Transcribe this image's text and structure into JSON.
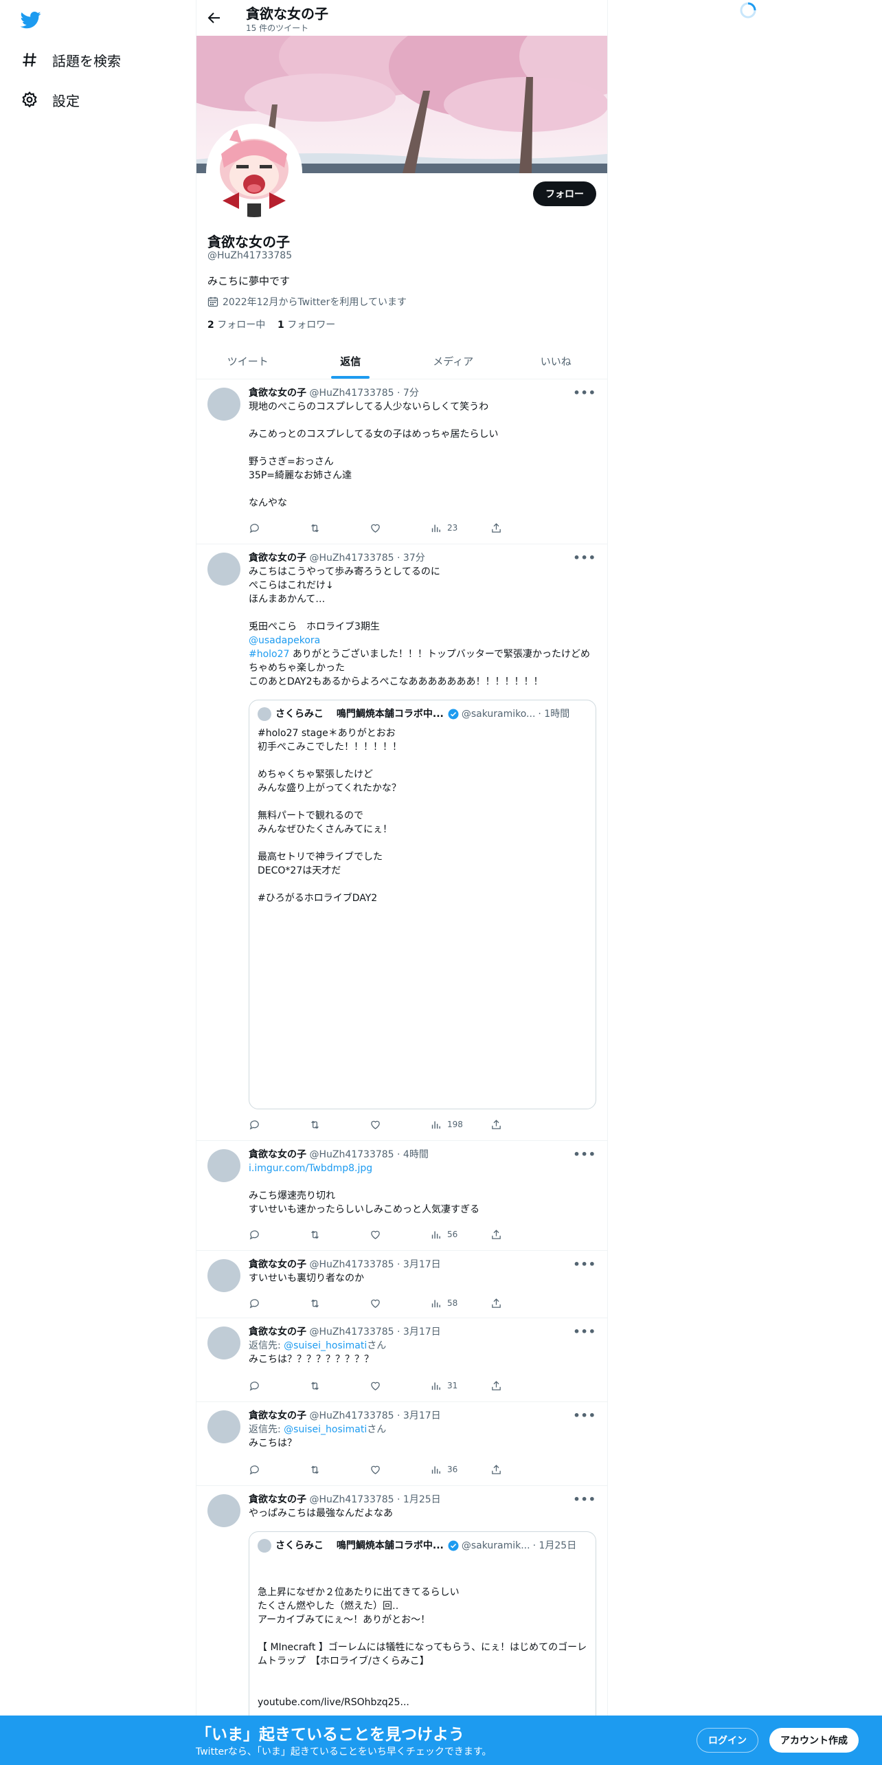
{
  "nav": {
    "explore_label": "話題を検索",
    "settings_label": "設定"
  },
  "header": {
    "title": "貪欲な女の子",
    "tweet_count": "15 件のツイート"
  },
  "profile": {
    "name": "貪欲な女の子",
    "handle": "@HuZh41733785",
    "bio": "みこちに夢中です",
    "joined": "2022年12月からTwitterを利用しています",
    "following_count": "2",
    "following_label": "フォロー中",
    "followers_count": "1",
    "followers_label": "フォロワー",
    "follow_button": "フォロー"
  },
  "tabs": [
    "ツイート",
    "返信",
    "メディア",
    "いいね"
  ],
  "tweets": [
    {
      "name": "貪欲な女の子",
      "handle": "@HuZh41733785",
      "time": "· 7分",
      "text": "現地のぺこらのコスプレしてる人少ないらしくて笑うわ\n\nみこめっとのコスプレしてる女の子はめっちゃ居たらしい\n\n野うさぎ=おっさん\n35P=綺麗なお姉さん達\n\nなんやな",
      "views": "23"
    },
    {
      "name": "貪欲な女の子",
      "handle": "@HuZh41733785",
      "time": "· 37分",
      "text_a": "みこちはこうやって歩み寄ろうとしてるのに\nぺこらはこれだけ↓\nほんまあかんて…\n\n兎田ぺこら　ホロライブ3期生",
      "link_a": "@usadapekora",
      "link_b": "#holo27",
      "text_b": " ありがとうございました！！！トップバッターで緊張凄かったけどめちゃめちゃ楽しかった\nこのあとDAY2もあるからよろぺこなあああああああ！！！！！！！",
      "quote": {
        "name": "さくらみこ　 鳴門鯛焼本舗コラボ中...",
        "handle": "@sakuramiko...",
        "time": "· 1時間",
        "text": "#holo27 stage＊ありがとおお\n初手ぺこみこでした！！！！！！\n\nめちゃくちゃ緊張したけど\nみんな盛り上がってくれたかな？\n\n無料パートで観れるので\nみんなぜひたくさんみてにぇ！\n\n最高セトリで神ライブでした\nDECO*27は天才だ\n\n#ひろがるホロライブDAY2"
      },
      "views": "198"
    },
    {
      "name": "貪欲な女の子",
      "handle": "@HuZh41733785",
      "time": "· 4時間",
      "link": "i.imgur.com/Twbdmp8.jpg",
      "text": "みこち爆速売り切れ\nすいせいも速かったらしいしみこめっと人気凄すぎる",
      "views": "56"
    },
    {
      "name": "貪欲な女の子",
      "handle": "@HuZh41733785",
      "time": "· 3月17日",
      "text": "すいせいも裏切り者なのか",
      "views": "58"
    },
    {
      "name": "貪欲な女の子",
      "handle": "@HuZh41733785",
      "time": "· 3月17日",
      "reply_prefix": "返信先: ",
      "reply_handle": "@suisei_hosimati",
      "reply_suffix": "さん",
      "text": "みこちは？？？？？？？？？",
      "views": "31"
    },
    {
      "name": "貪欲な女の子",
      "handle": "@HuZh41733785",
      "time": "· 3月17日",
      "reply_prefix": "返信先: ",
      "reply_handle": "@suisei_hosimati",
      "reply_suffix": "さん",
      "text": "みこちは？",
      "views": "36"
    },
    {
      "name": "貪欲な女の子",
      "handle": "@HuZh41733785",
      "time": "· 1月25日",
      "text": "やっぱみこちは最強なんだよなあ",
      "quote": {
        "name": "さくらみこ　 鳴門鯛焼本舗コラボ中...",
        "handle": "@sakuramik...",
        "time": "· 1月25日",
        "text": "急上昇になぜか２位あたりに出てきてるらしい\nたくさん燃やした（燃えた）回‥\nアーカイブみてにぇ～！ありがとお～！\n\n【 MInecraft 】ゴーレムには犠牲になってもらう、にぇ！はじめてのゴーレムトラップ　【ホロライブ/さくらみこ】",
        "link": "youtube.com/live/RSOhbzq25..."
      }
    }
  ],
  "more_label": "•••",
  "bottom": {
    "title": "「いま」起きていることを見つけよう",
    "subtitle": "Twitterなら、「いま」起きていることをいち早くチェックできます。",
    "login": "ログイン",
    "signup": "アカウント作成"
  },
  "colors": {
    "accent": "#1d9bf0",
    "text": "#0f1419",
    "muted": "#536471"
  }
}
